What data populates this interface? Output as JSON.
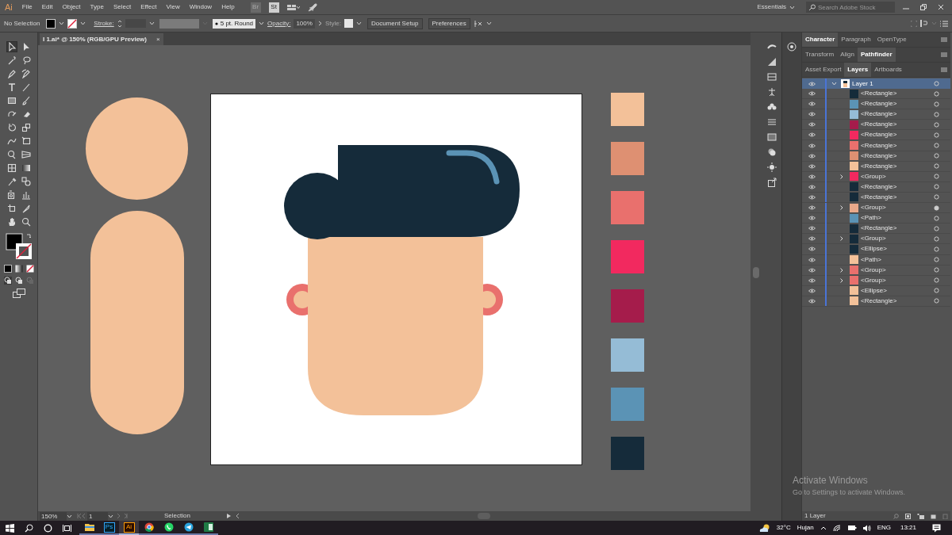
{
  "app_logo": "Ai",
  "menu": [
    "File",
    "Edit",
    "Object",
    "Type",
    "Select",
    "Effect",
    "View",
    "Window",
    "Help"
  ],
  "app_bar_badges": [
    {
      "label": "Br",
      "disabled": true
    },
    {
      "label": "St",
      "disabled": false
    }
  ],
  "workspace": {
    "label": "Essentials"
  },
  "stock_search": {
    "placeholder": "Search Adobe Stock"
  },
  "control_bar": {
    "selection": "No Selection",
    "stroke_label": "Stroke:",
    "brush": "5 pt. Round",
    "opacity_label": "Opacity:",
    "opacity": "100%",
    "style_label": "Style:",
    "buttons": [
      "Document Setup",
      "Preferences"
    ]
  },
  "document_tab": {
    "title": "I 1.ai* @ 150% (RGB/GPU Preview)",
    "close": "×"
  },
  "swatches": [
    {
      "color": "#f3c199"
    },
    {
      "color": "#de9072"
    },
    {
      "color": "#e9706d"
    },
    {
      "color": "#f2295f"
    },
    {
      "color": "#a51c4b"
    },
    {
      "color": "#95bcd6"
    },
    {
      "color": "#5b93b5"
    },
    {
      "color": "#152b3a"
    }
  ],
  "panels": {
    "tab_groups": [
      [
        {
          "label": "Character",
          "selected": true
        },
        {
          "label": "Paragraph",
          "selected": false
        },
        {
          "label": "OpenType",
          "selected": false
        }
      ],
      [
        {
          "label": "Transform",
          "selected": false
        },
        {
          "label": "Align",
          "selected": false
        },
        {
          "label": "Pathfinder",
          "selected": true
        }
      ],
      [
        {
          "label": "Asset Export",
          "selected": false
        },
        {
          "label": "Layers",
          "selected": true
        },
        {
          "label": "Artboards",
          "selected": false
        }
      ]
    ],
    "layer": {
      "name": "Layer 1",
      "expanded": true,
      "selected": true,
      "children": [
        {
          "name": "<Rectangle>",
          "expandable": false,
          "targeted": false,
          "color": "#152b3a"
        },
        {
          "name": "<Rectangle>",
          "expandable": false,
          "targeted": false,
          "color": "#5b93b5"
        },
        {
          "name": "<Rectangle>",
          "expandable": false,
          "targeted": false,
          "color": "#95bcd6"
        },
        {
          "name": "<Rectangle>",
          "expandable": false,
          "targeted": false,
          "color": "#a51c4b"
        },
        {
          "name": "<Rectangle>",
          "expandable": false,
          "targeted": false,
          "color": "#f2295f"
        },
        {
          "name": "<Rectangle>",
          "expandable": false,
          "targeted": false,
          "color": "#e9706d"
        },
        {
          "name": "<Rectangle>",
          "expandable": false,
          "targeted": false,
          "color": "#de9072"
        },
        {
          "name": "<Rectangle>",
          "expandable": false,
          "targeted": false,
          "color": "#f3c199"
        },
        {
          "name": "<Group>",
          "expandable": true,
          "targeted": false,
          "color": "#f2295f"
        },
        {
          "name": "<Rectangle>",
          "expandable": false,
          "targeted": false,
          "color": "#152b3a"
        },
        {
          "name": "<Rectangle>",
          "expandable": false,
          "targeted": false,
          "color": "#152b3a"
        },
        {
          "name": "<Group>",
          "expandable": true,
          "targeted": true,
          "color": "#e9a98a"
        },
        {
          "name": "<Path>",
          "expandable": false,
          "targeted": false,
          "color": "#5b93b5"
        },
        {
          "name": "<Rectangle>",
          "expandable": false,
          "targeted": false,
          "color": "#152b3a"
        },
        {
          "name": "<Group>",
          "expandable": true,
          "targeted": false,
          "color": "#152b3a"
        },
        {
          "name": "<Ellipse>",
          "expandable": false,
          "targeted": false,
          "color": "#152b3a"
        },
        {
          "name": "<Path>",
          "expandable": false,
          "targeted": false,
          "color": "#f3c199"
        },
        {
          "name": "<Group>",
          "expandable": true,
          "targeted": false,
          "color": "#e9706d"
        },
        {
          "name": "<Group>",
          "expandable": true,
          "targeted": false,
          "color": "#e9706d"
        },
        {
          "name": "<Ellipse>",
          "expandable": false,
          "targeted": false,
          "color": "#f3c199"
        },
        {
          "name": "<Rectangle>",
          "expandable": false,
          "targeted": false,
          "color": "#f3c199"
        }
      ]
    },
    "footer": "1 Layer"
  },
  "status_bar": {
    "zoom": "150%",
    "artboard": "1",
    "tool": "Selection"
  },
  "activation_notice": {
    "title": "Activate Windows",
    "body": "Go to Settings to activate Windows."
  },
  "taskbar": {
    "apps": [
      {
        "kind": "folder",
        "selected": false
      },
      {
        "kind": "ps",
        "label": "Ps",
        "selected": false
      },
      {
        "kind": "ai",
        "label": "Ai",
        "selected": true
      },
      {
        "kind": "chrome",
        "selected": false
      },
      {
        "kind": "whatsapp",
        "selected": false
      },
      {
        "kind": "telegram",
        "selected": false
      },
      {
        "kind": "excel",
        "selected": false
      }
    ],
    "weather": {
      "temperature": "32°C",
      "condition": "Hujan"
    },
    "language": "ENG",
    "clock": "13:21"
  }
}
